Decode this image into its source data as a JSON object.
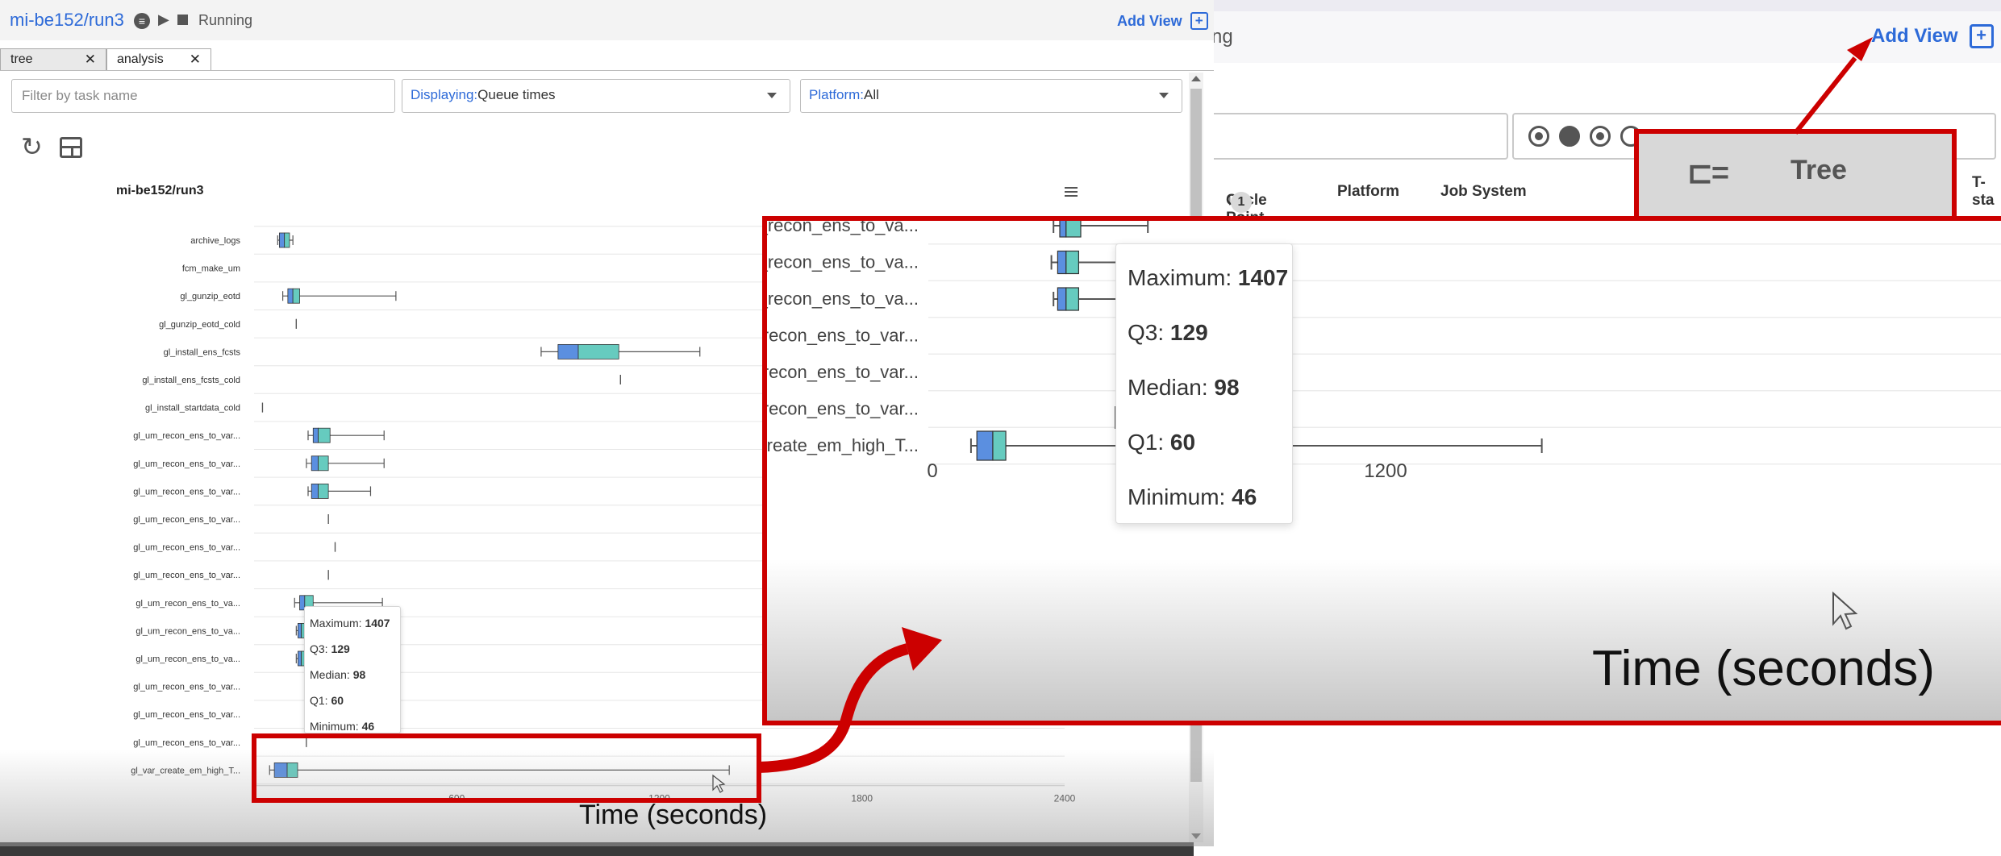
{
  "background_window": {
    "status_partial": "ng",
    "add_view_label": "Add View",
    "table_headers": {
      "cycle_point": "Cycle Point",
      "sort_badge": "1",
      "platform": "Platform",
      "job_system": "Job System",
      "t_start": "T-sta"
    },
    "tree_view_label": "Tree"
  },
  "window": {
    "workflow_name": "mi-be152/run3",
    "status": "Running",
    "add_view_label": "Add View"
  },
  "tabs": [
    {
      "label": "tree",
      "active": false
    },
    {
      "label": "analysis",
      "active": true
    }
  ],
  "filters": {
    "task_name_placeholder": "Filter by task name",
    "displaying_label": "Displaying:",
    "displaying_value": "Queue times",
    "platform_label": "Platform:",
    "platform_value": "All"
  },
  "chart_data": {
    "type": "boxplot",
    "title": "mi-be152/run3",
    "xlabel": "",
    "xlim": [
      0,
      2400
    ],
    "xticks": [
      "0",
      "600",
      "1200",
      "1800",
      "2400"
    ],
    "categories": [
      "archive_logs",
      "fcm_make_um",
      "gl_gunzip_eotd",
      "gl_gunzip_eotd_cold",
      "gl_install_ens_fcsts",
      "gl_install_ens_fcsts_cold",
      "gl_install_startdata_cold",
      "gl_um_recon_ens_to_var...",
      "gl_um_recon_ens_to_var...",
      "gl_um_recon_ens_to_var...",
      "gl_um_recon_ens_to_var...",
      "gl_um_recon_ens_to_var...",
      "gl_um_recon_ens_to_var...",
      "gl_um_recon_ens_to_va...",
      "gl_um_recon_ens_to_va...",
      "gl_um_recon_ens_to_va...",
      "gl_um_recon_ens_to_var...",
      "gl_um_recon_ens_to_var...",
      "gl_um_recon_ens_to_var...",
      "gl_var_create_em_high_T..."
    ],
    "boxes": [
      {
        "min": 70,
        "q1": 75,
        "median": 90,
        "q3": 105,
        "max": 115
      },
      null,
      {
        "min": 85,
        "q1": 100,
        "median": 115,
        "q3": 135,
        "max": 420
      },
      {
        "min": 125,
        "q1": 125,
        "median": 125,
        "q3": 125,
        "max": 125
      },
      {
        "min": 850,
        "q1": 900,
        "median": 960,
        "q3": 1080,
        "max": 1320
      },
      {
        "min": 1085,
        "q1": 1085,
        "median": 1085,
        "q3": 1085,
        "max": 1085
      },
      {
        "min": 25,
        "q1": 25,
        "median": 25,
        "q3": 25,
        "max": 25
      },
      {
        "min": 160,
        "q1": 175,
        "median": 190,
        "q3": 225,
        "max": 385
      },
      {
        "min": 155,
        "q1": 170,
        "median": 190,
        "q3": 220,
        "max": 385
      },
      {
        "min": 160,
        "q1": 170,
        "median": 190,
        "q3": 220,
        "max": 345
      },
      {
        "min": 220,
        "q1": 220,
        "median": 220,
        "q3": 220,
        "max": 220
      },
      {
        "min": 240,
        "q1": 240,
        "median": 240,
        "q3": 240,
        "max": 240
      },
      {
        "min": 220,
        "q1": 220,
        "median": 220,
        "q3": 220,
        "max": 220
      },
      {
        "min": 120,
        "q1": 135,
        "median": 150,
        "q3": 175,
        "max": 380
      },
      {
        "min": 125,
        "q1": 130,
        "median": 140,
        "q3": 150,
        "max": 150
      },
      {
        "min": 125,
        "q1": 130,
        "median": 140,
        "q3": 150,
        "max": 150
      },
      null,
      null,
      {
        "min": 155,
        "q1": 155,
        "median": 155,
        "q3": 155,
        "max": 155
      },
      {
        "min": 46,
        "q1": 60,
        "median": 98,
        "q3": 129,
        "max": 1407
      }
    ],
    "colors": {
      "lower_box": "#5b8fe0",
      "upper_box": "#66cbbf",
      "whisker": "#555555"
    }
  },
  "tooltip": {
    "maximum_label": "Maximum:",
    "maximum": "1407",
    "q3_label": "Q3:",
    "q3": "129",
    "median_label": "Median:",
    "median": "98",
    "q1_label": "Q1:",
    "q1": "60",
    "minimum_label": "Minimum:",
    "minimum": "46"
  },
  "zoom_callout": {
    "rows": [
      "gl_um_recon_ens_to_va...",
      "gl_um_recon_ens_to_va...",
      "gl_um_recon_ens_to_va...",
      "gl_um_recon_ens_to_var...",
      "gl_um_recon_ens_to_var...",
      "gl_um_recon_ens_to_var...",
      "gl_var_create_em_high_T..."
    ],
    "xticks": [
      "0",
      "600",
      "1200"
    ],
    "axis_title": "Time (seconds)"
  },
  "annotation": {
    "axis_title": "Time (seconds)",
    "highlight_color": "#cc0000"
  }
}
